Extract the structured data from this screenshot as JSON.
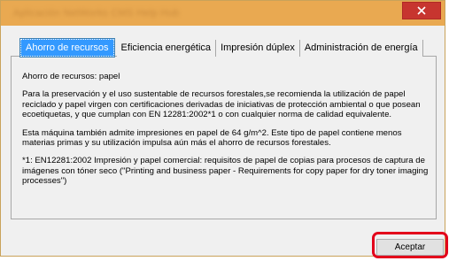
{
  "window": {
    "title": "Aplicación NetWorks CMS Help Hub"
  },
  "tabs": [
    {
      "label": "Ahorro de recursos",
      "active": true
    },
    {
      "label": "Eficiencia energética",
      "active": false
    },
    {
      "label": "Impresión dúplex",
      "active": false
    },
    {
      "label": "Administración de energía",
      "active": false
    }
  ],
  "content": {
    "heading": "Ahorro de recursos: papel",
    "p1": "Para la preservación y el uso sustentable de recursos forestales,se recomienda la utilización de papel reciclado y papel virgen con certificaciones derivadas de iniciativas de protección ambiental o que posean ecoetiquetas, y que cumplan con EN 12281:2002*1 o con cualquier norma de calidad equivalente.",
    "p2": "Esta máquina también admite impresiones en papel de 64 g/m^2.  Este tipo de papel contiene menos materias primas y su utilización impulsa aún más el ahorro de recursos forestales.",
    "p3": "*1: EN12281:2002 Impresión y papel comercial: requisitos de papel de copias para procesos de captura de imágenes con tóner seco (\"Printing and business paper - Requirements for copy paper for dry toner imaging processes\")"
  },
  "footer": {
    "accept_label": "Aceptar"
  },
  "colors": {
    "titlebar": "#e9a951",
    "close": "#c7352f",
    "tab_active": "#3399ff",
    "highlight": "#e3001b"
  }
}
